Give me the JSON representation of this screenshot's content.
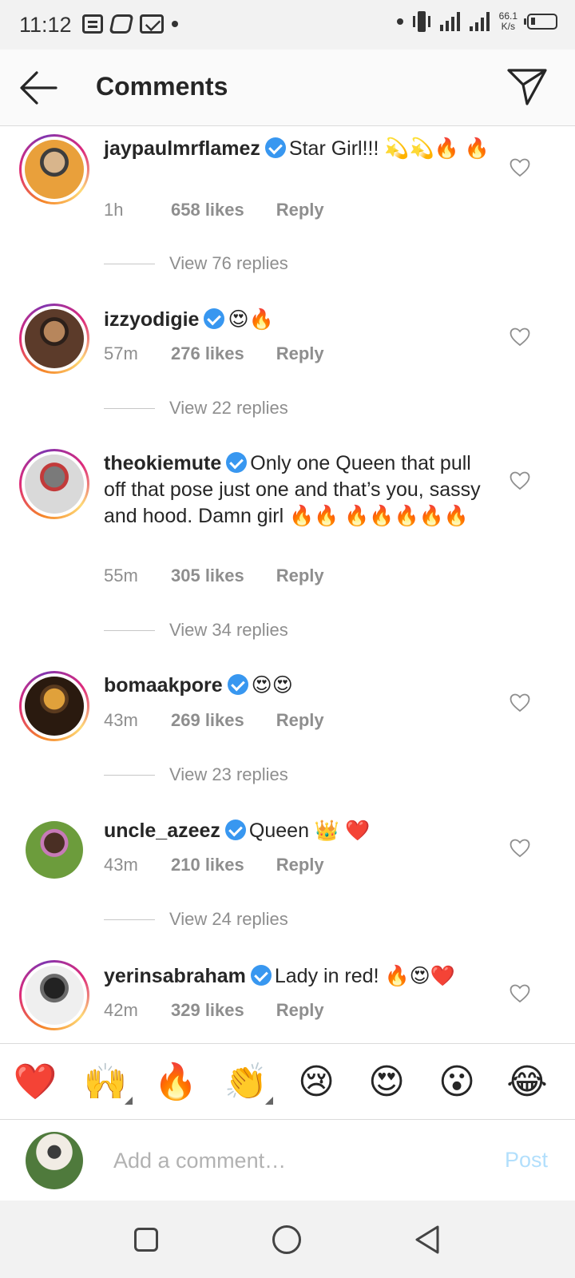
{
  "status_bar": {
    "time": "11:12",
    "network_speed_value": "66.1",
    "network_speed_unit": "K/s",
    "icons": [
      "document-icon",
      "tile-icon",
      "mail-icon",
      "dot-icon",
      "vibrate-icon",
      "signal-icon",
      "signal-icon",
      "battery-icon"
    ]
  },
  "header": {
    "title": "Comments",
    "back_icon": "arrow-left-icon",
    "send_icon": "paper-plane-icon"
  },
  "comments": [
    {
      "username": "jaypaulmrflamez",
      "verified": true,
      "text": "Star Girl!!! 💫💫🔥 🔥",
      "time": "1h",
      "likes": "658 likes",
      "reply_label": "Reply",
      "view_replies": "View 76 replies",
      "ring": true,
      "avatar_colors": [
        "#e9a03b",
        "#d8b58c",
        "#3d3d3d"
      ]
    },
    {
      "username": "izzyodigie",
      "verified": true,
      "text": "😍🔥",
      "time": "57m",
      "likes": "276 likes",
      "reply_label": "Reply",
      "view_replies": "View 22 replies",
      "ring": true,
      "avatar_colors": [
        "#5c3b2a",
        "#b7865c",
        "#2d201a"
      ]
    },
    {
      "username": "theokiemute",
      "verified": true,
      "text": "Only one Queen that pull off that pose just one and that’s you, sassy and hood. Damn girl 🔥🔥 🔥🔥🔥🔥🔥",
      "time": "55m",
      "likes": "305 likes",
      "reply_label": "Reply",
      "view_replies": "View 34 replies",
      "ring": true,
      "avatar_colors": [
        "#d9d9d9",
        "#7a7a7a",
        "#c23a3a"
      ]
    },
    {
      "username": "bomaakpore",
      "verified": true,
      "text": "😍😍",
      "time": "43m",
      "likes": "269 likes",
      "reply_label": "Reply",
      "view_replies": "View 23 replies",
      "ring": true,
      "avatar_colors": [
        "#2a1a0f",
        "#e0a13b",
        "#5a3a1e"
      ]
    },
    {
      "username": "uncle_azeez",
      "verified": true,
      "text": "Queen 👑 ❤️",
      "time": "43m",
      "likes": "210 likes",
      "reply_label": "Reply",
      "view_replies": "View 24 replies",
      "ring": false,
      "avatar_colors": [
        "#6c9c3c",
        "#4a2f24",
        "#c77ab8"
      ]
    },
    {
      "username": "yerinsabraham",
      "verified": true,
      "text": "Lady in red! 🔥😍❤️",
      "time": "42m",
      "likes": "329 likes",
      "reply_label": "Reply",
      "view_replies": "",
      "ring": true,
      "avatar_colors": [
        "#efefef",
        "#222222",
        "#6a6a6a"
      ]
    }
  ],
  "emoji_bar": [
    "❤️",
    "🙌",
    "🔥",
    "👏",
    "😢",
    "😍",
    "😮",
    "😂"
  ],
  "add_comment": {
    "placeholder": "Add a comment…",
    "post_label": "Post"
  },
  "nav_bar": [
    "square-icon",
    "circle-icon",
    "triangle-back-icon"
  ]
}
